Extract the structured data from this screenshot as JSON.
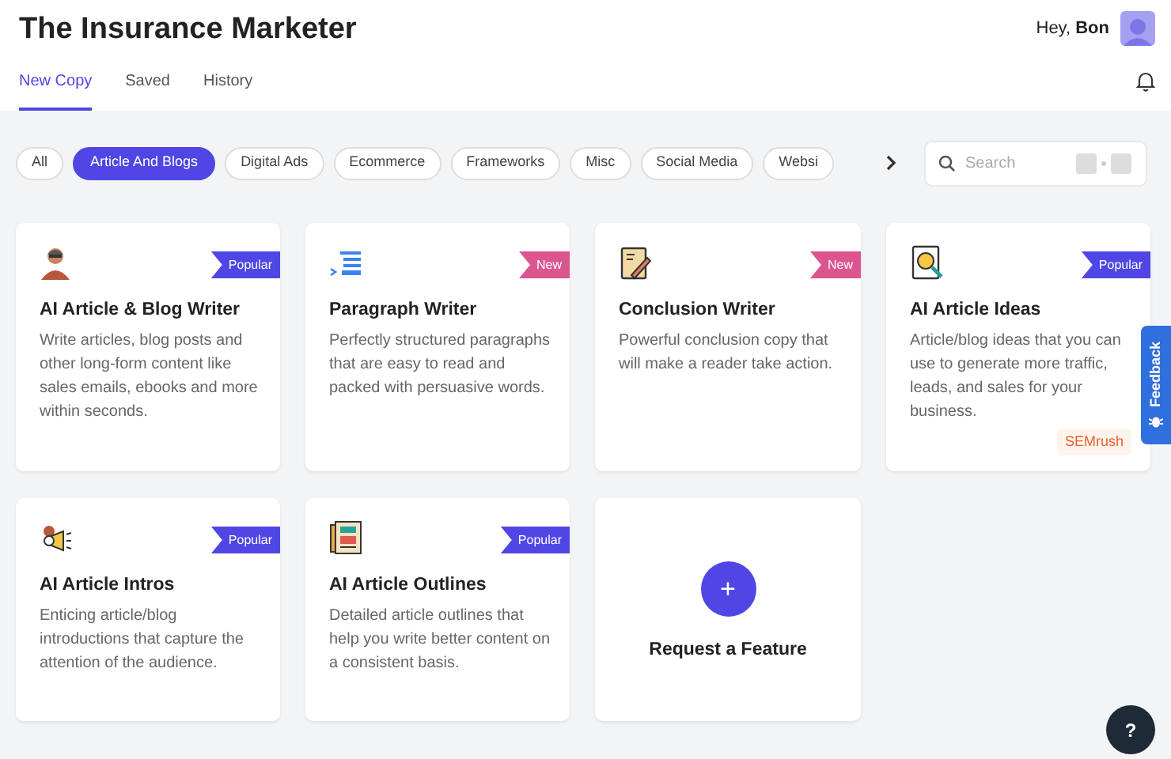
{
  "app_title": "The Insurance Marketer",
  "greeting": {
    "text": "Hey,",
    "name": "Bon"
  },
  "tabs": [
    {
      "label": "New Copy",
      "selected": true
    },
    {
      "label": "Saved",
      "selected": false
    },
    {
      "label": "History",
      "selected": false
    }
  ],
  "categories": [
    {
      "label": "All",
      "selected": false
    },
    {
      "label": "Article And Blogs",
      "selected": true
    },
    {
      "label": "Digital Ads",
      "selected": false
    },
    {
      "label": "Ecommerce",
      "selected": false
    },
    {
      "label": "Frameworks",
      "selected": false
    },
    {
      "label": "Misc",
      "selected": false
    },
    {
      "label": "Social Media",
      "selected": false
    },
    {
      "label": "Websi",
      "selected": false
    }
  ],
  "search": {
    "placeholder": "Search"
  },
  "cards": [
    {
      "title": "AI Article & Blog Writer",
      "description": "Write articles, blog posts and other long-form content like sales emails, ebooks and more within seconds.",
      "badge": {
        "label": "Popular",
        "color": "#4f46e5"
      }
    },
    {
      "title": "Paragraph Writer",
      "description": "Perfectly structured paragraphs that are easy to read and packed with persuasive words.",
      "badge": {
        "label": "New",
        "color": "#db5690"
      }
    },
    {
      "title": "Conclusion Writer",
      "description": "Powerful conclusion copy that will make a reader take action.",
      "badge": {
        "label": "New",
        "color": "#db5690"
      }
    },
    {
      "title": "AI Article Ideas",
      "description": "Article/blog ideas that you can use to generate more traffic, leads, and sales for your business.",
      "badge": {
        "label": "Popular",
        "color": "#4f46e5"
      },
      "tag": "SEMrush"
    },
    {
      "title": "AI Article Intros",
      "description": "Enticing article/blog introductions that capture the attention of the audience.",
      "badge": {
        "label": "Popular",
        "color": "#4f46e5"
      }
    },
    {
      "title": "AI Article Outlines",
      "description": "Detailed article outlines that help you write better content on a consistent basis.",
      "badge": {
        "label": "Popular",
        "color": "#4f46e5"
      }
    }
  ],
  "request_card": {
    "icon": "+",
    "label": "Request a Feature"
  },
  "feedback_tab": "Feedback",
  "help_button": "?"
}
